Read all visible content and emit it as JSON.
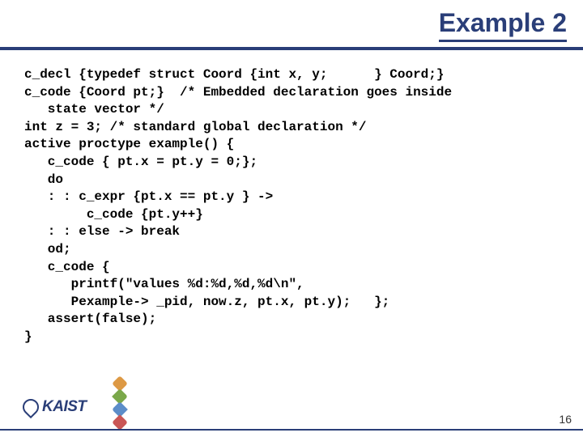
{
  "title": "Example 2",
  "code": {
    "l0": "c_decl {typedef struct Coord {int x, y;      } Coord;}",
    "l1": "c_code {Coord pt;}  /* Embedded declaration goes inside",
    "l2": "   state vector */",
    "l3": "int z = 3; /* standard global declaration */",
    "l4": "active proctype example() {",
    "l5": "   c_code { pt.x = pt.y = 0;};",
    "l6": "   do",
    "l7": "   : : c_expr {pt.x == pt.y } ->",
    "l8": "        c_code {pt.y++}",
    "l9": "   : : else -> break",
    "l10": "   od;",
    "l11": "   c_code {",
    "l12": "      printf(\"values %d:%d,%d,%d\\n\",",
    "l13": "      Pexample-> _pid, now.z, pt.x, pt.y);   };",
    "l14": "   assert(false);",
    "l15": "}"
  },
  "brand": "KAIST",
  "page_number": "16"
}
